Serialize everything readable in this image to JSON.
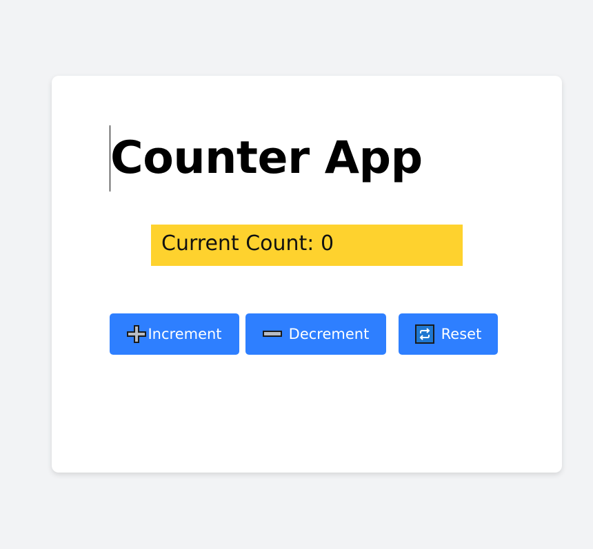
{
  "app": {
    "title": "Counter App",
    "count_label": "Current Count: 0",
    "count_value": 0
  },
  "buttons": {
    "increment": {
      "label": "Increment",
      "icon": "plus-icon"
    },
    "decrement": {
      "label": "Decrement",
      "icon": "minus-icon"
    },
    "reset": {
      "label": "Reset",
      "icon": "repeat-icon"
    }
  },
  "colors": {
    "background": "#f2f3f5",
    "card": "#ffffff",
    "count_highlight": "#fed22e",
    "button": "#2e7fff",
    "button_text": "#ffffff"
  }
}
